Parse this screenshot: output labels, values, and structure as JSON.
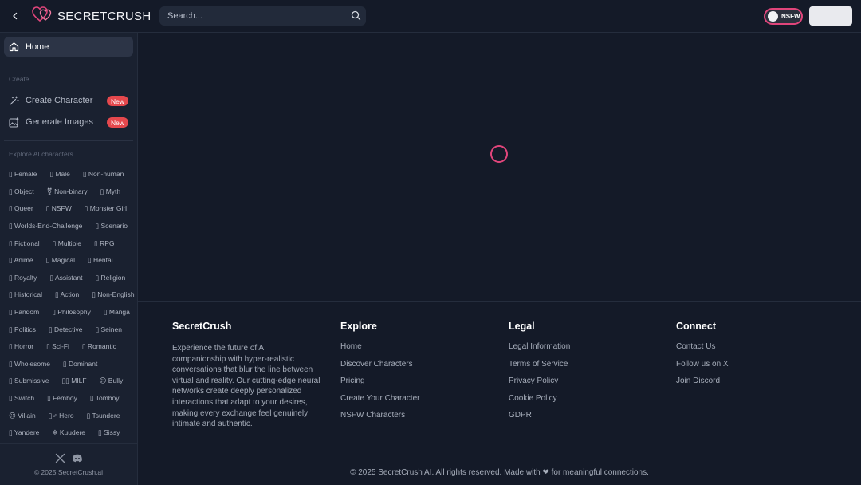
{
  "header": {
    "logo_text": "SECRETCRUSH",
    "search_placeholder": "Search...",
    "nsfw_toggle_label": "NSFW",
    "accent_color": "#e0457b"
  },
  "sidebar": {
    "home_label": "Home",
    "create_section": "Create",
    "create_items": [
      {
        "label": "Create Character",
        "badge": "New",
        "icon": "magic-wand-icon"
      },
      {
        "label": "Generate Images",
        "badge": "New",
        "icon": "image-plus-icon"
      }
    ],
    "explore_section": "Explore AI characters",
    "tag_rows": [
      [
        "▯ Female",
        "▯ Male",
        "▯ Non-human"
      ],
      [
        "▯ Object",
        "⚧ Non-binary",
        "▯ Myth"
      ],
      [
        "▯ Queer",
        "▯ NSFW",
        "▯ Monster Girl"
      ],
      [
        "▯ Worlds-End-Challenge",
        "▯ Scenario"
      ],
      [
        "▯ Fictional",
        "▯ Multiple",
        "▯ RPG"
      ],
      [
        "▯ Anime",
        "▯ Magical",
        "▯ Hentai"
      ],
      [
        "▯ Royalty",
        "▯ Assistant",
        "▯ Religion"
      ],
      [
        "▯ Historical",
        "▯ Action",
        "▯ Non-English"
      ],
      [
        "▯ Fandom",
        "▯ Philosophy",
        "▯ Manga"
      ],
      [
        "▯ Politics",
        "▯ Detective",
        "▯ Seinen"
      ],
      [
        "▯ Horror",
        "▯ Sci-Fi",
        "▯ Romantic"
      ],
      [
        "▯ Wholesome",
        "▯ Dominant"
      ],
      [
        "▯ Submissive",
        "▯▯ MILF",
        "☹ Bully"
      ],
      [
        "▯ Switch",
        "▯ Femboy",
        "▯ Tomboy"
      ],
      [
        "☹ Villain",
        "▯♂ Hero",
        "▯ Tsundere"
      ],
      [
        "▯ Yandere",
        "❄ Kuudere",
        "▯ Sissy"
      ]
    ],
    "copyright": "© 2025 SecretCrush.ai"
  },
  "footer": {
    "brand": {
      "title": "SecretCrush",
      "description": "Experience the future of AI companionship with hyper-realistic conversations that blur the line between virtual and reality. Our cutting-edge neural networks create deeply personalized interactions that adapt to your desires, making every exchange feel genuinely intimate and authentic."
    },
    "explore": {
      "title": "Explore",
      "links": [
        "Home",
        "Discover Characters",
        "Pricing",
        "Create Your Character",
        "NSFW Characters"
      ]
    },
    "legal": {
      "title": "Legal",
      "links": [
        "Legal Information",
        "Terms of Service",
        "Privacy Policy",
        "Cookie Policy",
        "GDPR"
      ]
    },
    "connect": {
      "title": "Connect",
      "links": [
        "Contact Us",
        "Follow us on X",
        "Join Discord"
      ]
    },
    "copyright": "© 2025 SecretCrush AI. All rights reserved.  Made with ❤ for meaningful connections."
  }
}
